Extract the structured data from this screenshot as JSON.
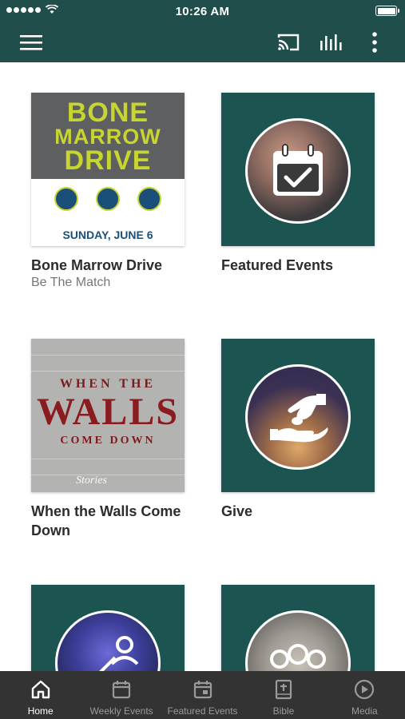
{
  "status_bar": {
    "time": "10:26 AM"
  },
  "app_bar": {
    "menu_icon": "hamburger-icon",
    "cast_icon": "cast-icon",
    "audio_icon": "equalizer-icon",
    "more_icon": "more-vertical-icon"
  },
  "cards": [
    {
      "title": "Bone Marrow Drive",
      "subtitle": "Be The Match",
      "image": {
        "line1": "BONE",
        "line2": "MARROW",
        "line3": "DRIVE",
        "date": "SUNDAY, JUNE 6"
      }
    },
    {
      "title": "Featured Events",
      "subtitle": "",
      "icon": "calendar-check-icon"
    },
    {
      "title": "When the Walls Come Down",
      "subtitle": "",
      "image": {
        "line1": "WHEN THE",
        "line2": "WALLS",
        "line3": "COME DOWN",
        "logo": "Stories"
      }
    },
    {
      "title": "Give",
      "subtitle": "",
      "icon": "giving-hands-icon"
    },
    {
      "title": "",
      "subtitle": "",
      "icon": "people-network-icon"
    },
    {
      "title": "",
      "subtitle": "",
      "icon": "group-icon"
    }
  ],
  "tab_bar": {
    "tabs": [
      {
        "label": "Home",
        "icon": "home-icon",
        "active": true
      },
      {
        "label": "Weekly Events",
        "icon": "calendar-icon",
        "active": false
      },
      {
        "label": "Featured Events",
        "icon": "calendar-event-icon",
        "active": false
      },
      {
        "label": "Bible",
        "icon": "bible-icon",
        "active": false
      },
      {
        "label": "Media",
        "icon": "play-circle-icon",
        "active": false
      }
    ]
  },
  "colors": {
    "header": "#1f4e4b",
    "tabbar": "#333333",
    "accent_teal": "#1b5450"
  }
}
